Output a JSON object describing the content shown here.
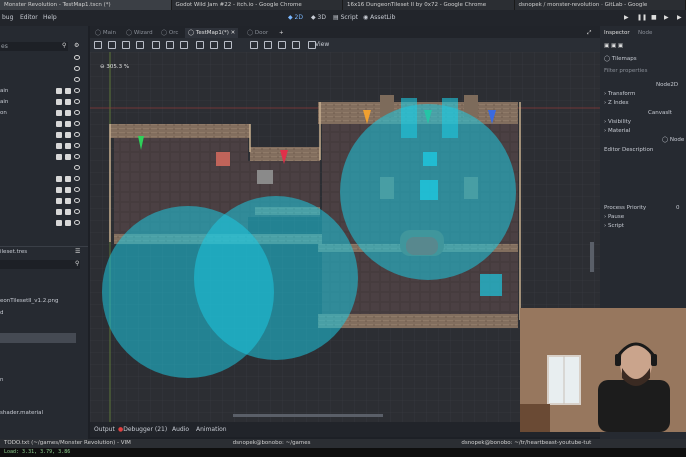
{
  "taskbar": {
    "tabs": [
      "Monster Revolution - TestMap1.tscn (*)",
      "Godot Wild Jam #22 - itch.io - Google Chrome",
      "16x16 DungeonTileset II by 0x72 - Google Chrome",
      "dsnopek / monster-revolution · GitLab - Google"
    ]
  },
  "menubar": {
    "items": [
      "bug",
      "Editor",
      "Help"
    ],
    "modes": [
      "2D",
      "3D",
      "Script",
      "AssetLib"
    ]
  },
  "scene_panel": {
    "filter_placeholder": "es",
    "rows": [
      "ain",
      "ain",
      "on",
      "",
      "",
      "",
      "",
      "",
      "",
      "",
      "",
      "",
      ""
    ]
  },
  "filesystem": {
    "path": "ileset.tres",
    "items": [
      "eonTilesetII_v1.2.png",
      "d",
      "",
      "",
      "n",
      "",
      "shader.material"
    ]
  },
  "scene_tabs": {
    "tabs": [
      "Main",
      "Wizard",
      "Orc",
      "TestMap1(*)",
      "Door"
    ]
  },
  "toolbar": {
    "view_label": "View"
  },
  "viewport": {
    "zoom": "305.3 %"
  },
  "bottom_tabs": [
    "Output",
    "Debugger (21)",
    "Audio",
    "Animation"
  ],
  "inspector": {
    "tabs": [
      "Inspector",
      "Node"
    ],
    "node_name": "Tilemaps",
    "filter_placeholder": "Filter properties",
    "class_node2d": "Node2D",
    "transform": "Transform",
    "zindex": "Z Index",
    "canvasitem": "CanvasIt",
    "visibility": "Visibility",
    "material": "Material",
    "class_node": "Node",
    "description": "Editor Description",
    "process_priority_label": "Process Priority",
    "process_priority_value": "0",
    "pause": "Pause",
    "script": "Script"
  },
  "status": {
    "items": [
      "TODO.txt (~/games/Monster Revolution) - VIM",
      "dsnopek@bonobo: ~/games",
      "dsnopek@bonobo: ~/tr/heartbeast-youtube-tut"
    ],
    "terminal": "Load: 3.31, 3.79, 3.86"
  },
  "colors": {
    "accent": "#7ab7ff",
    "overlay": "#1ec8e0",
    "floor": "#463c3e",
    "wall": "#8f7a68"
  }
}
